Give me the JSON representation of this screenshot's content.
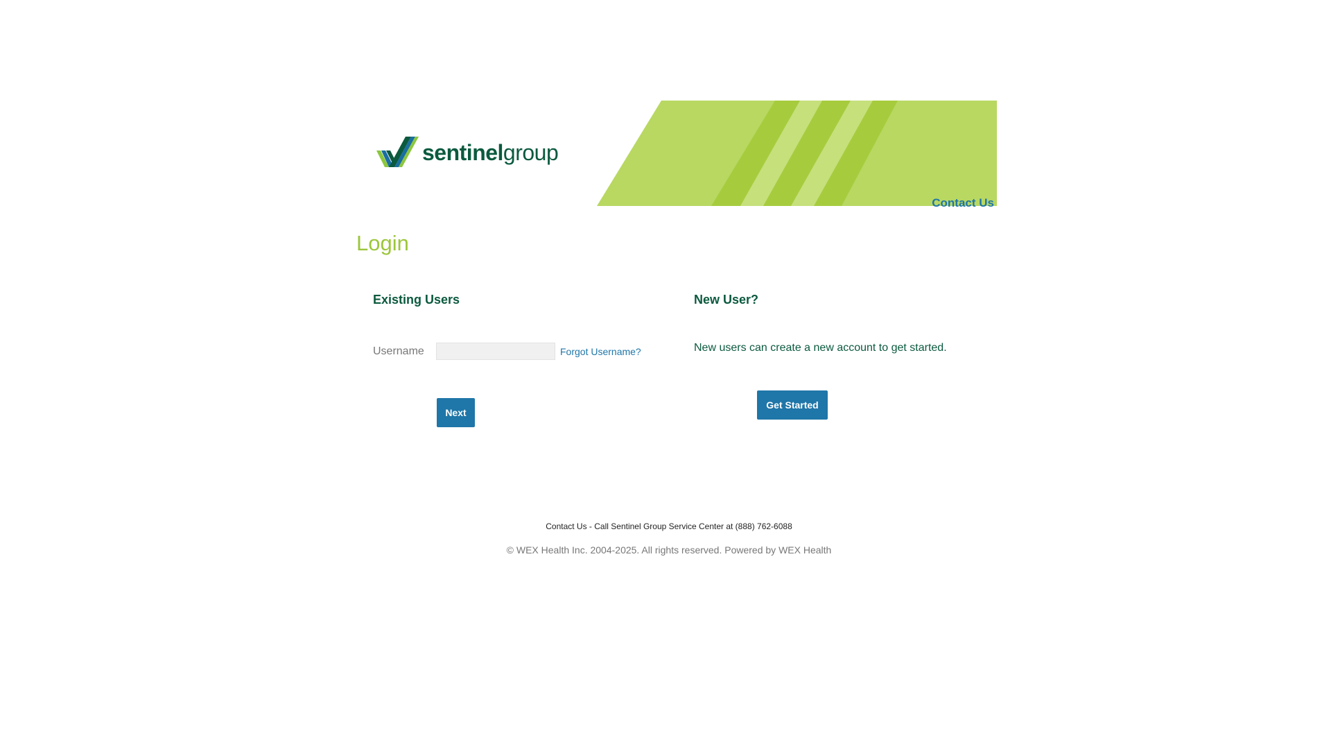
{
  "header": {
    "logo": {
      "text_bold": "sentinel",
      "text_light": "group",
      "icon": "sentinel-checkmark-logo-icon"
    },
    "contact_link": "Contact Us",
    "colors": {
      "banner_light": "#b8d862",
      "banner_stripe": "#a6cc3e",
      "banner_pale": "#c6e07c"
    }
  },
  "page_title": "Login",
  "existing_users": {
    "heading": "Existing Users",
    "username_label": "Username",
    "username_value": "",
    "forgot_link": "Forgot Username?",
    "next_button": "Next"
  },
  "new_user": {
    "heading": "New User?",
    "description": "New users can create a new account to get started.",
    "get_started_button": "Get Started"
  },
  "footer": {
    "contact": "Contact Us - Call Sentinel Group Service Center at (888) 762-6088",
    "copyright": "© WEX Health Inc. 2004-2025. All rights reserved. Powered by WEX Health"
  },
  "colors": {
    "primary_button": "#1f76a8",
    "heading_green": "#0b5a3e",
    "title_lime": "#9cc63b",
    "link_blue": "#1f76a8"
  }
}
